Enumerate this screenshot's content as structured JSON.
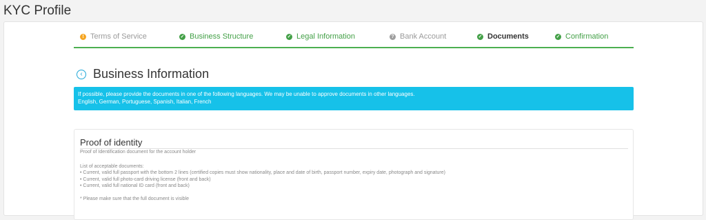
{
  "page": {
    "title": "KYC Profile"
  },
  "steps": [
    {
      "label": "Terms of Service",
      "status": "warning",
      "icon": "exclamation-icon"
    },
    {
      "label": "Business Structure",
      "status": "done",
      "icon": "check-icon"
    },
    {
      "label": "Legal Information",
      "status": "done",
      "icon": "check-icon"
    },
    {
      "label": "Bank Account",
      "status": "pending",
      "icon": "question-icon"
    },
    {
      "label": "Documents",
      "status": "active",
      "icon": "check-icon"
    },
    {
      "label": "Confirmation",
      "status": "done",
      "icon": "check-icon"
    }
  ],
  "section": {
    "title": "Business Information"
  },
  "notice": {
    "line1": "If possible, please provide the documents in one of the following languages. We may be unable to approve documents in other languages.",
    "line2": "English, German, Portuguese, Spanish, Italian, French"
  },
  "proof": {
    "title": "Proof of identity",
    "subtitle": "Proof of Identification document for the account holder",
    "list_heading": "List of acceptable documents:",
    "items": [
      "• Current, valid full passport with the bottom 2 lines (certified copies must show nationality, place and date of birth, passport number, expiry date, photograph and signature)",
      "• Current, valid full photo-card driving license (front and back)",
      "• Current, valid full national ID card (front and back)"
    ],
    "note": "* Please make sure that the full document is visible"
  },
  "colors": {
    "accent_green": "#43a047",
    "notice_blue": "#16c1e9",
    "warning_orange": "#f5a623"
  }
}
